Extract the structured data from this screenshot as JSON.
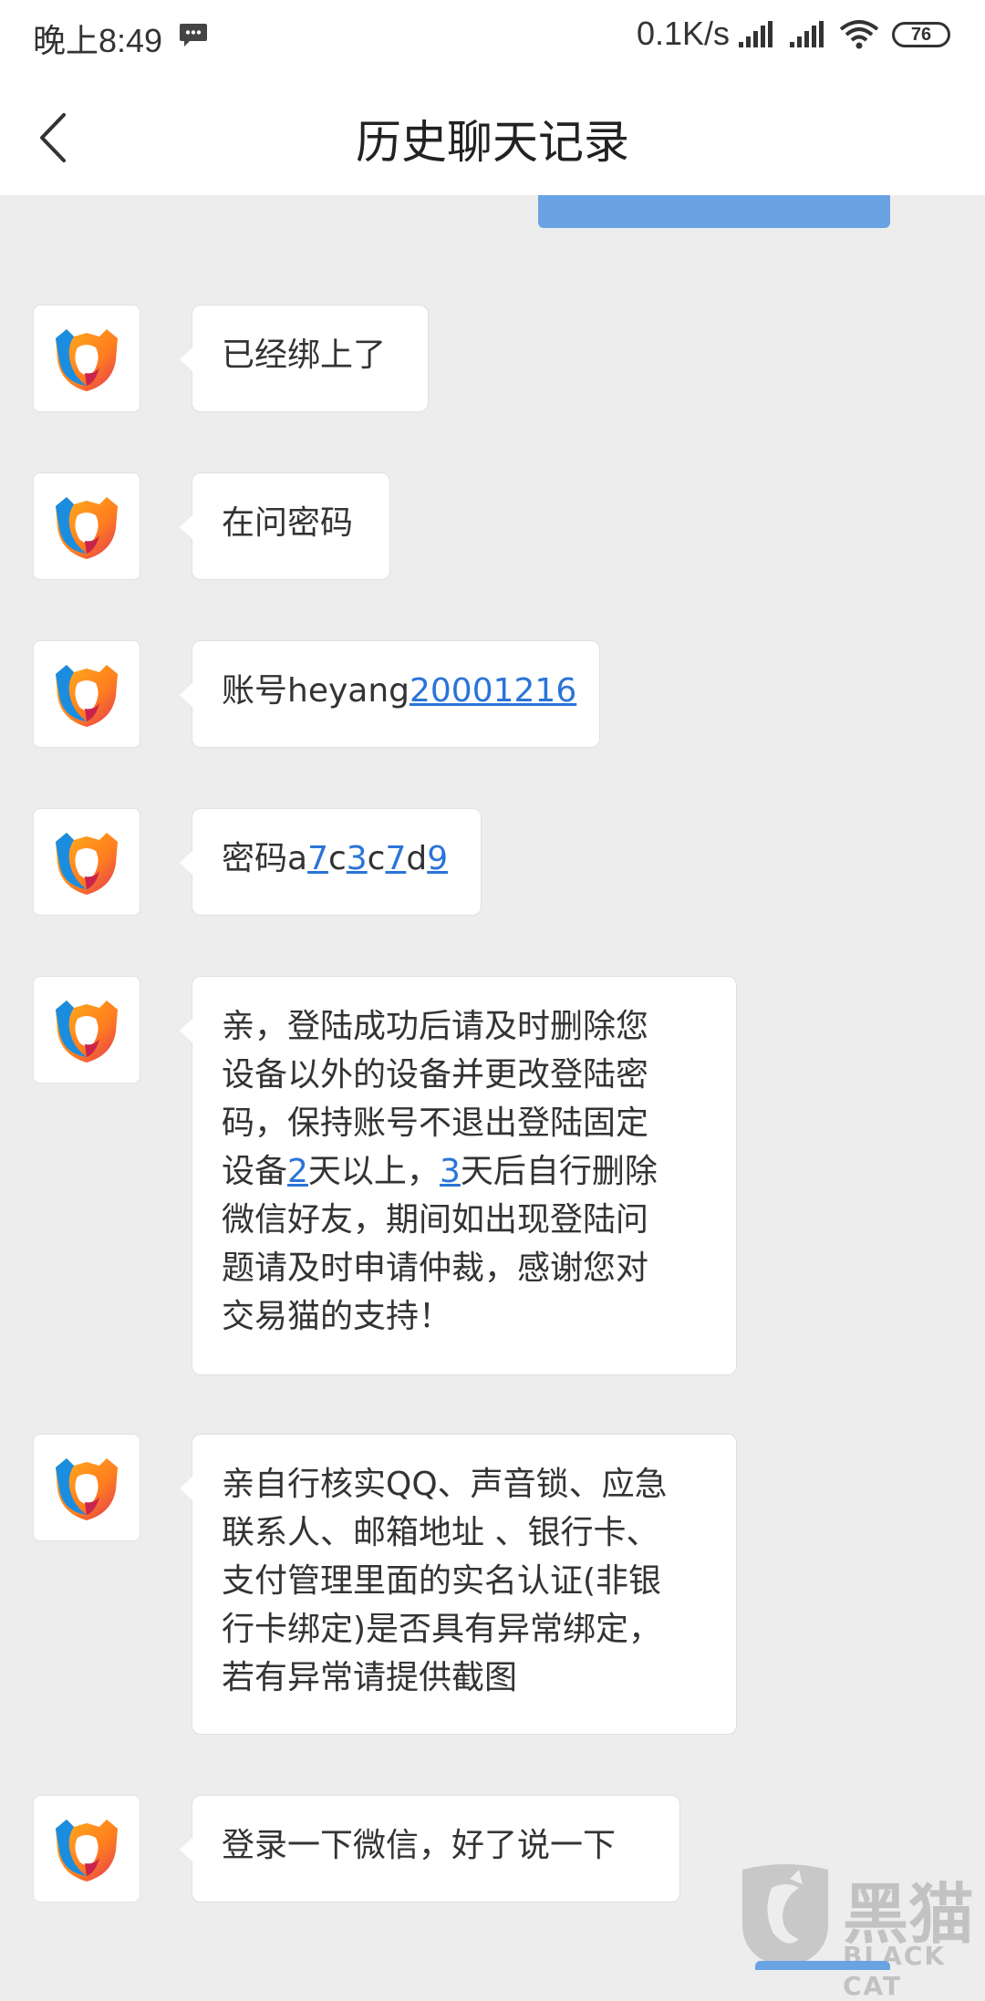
{
  "status_bar": {
    "time": "晚上8:49",
    "network_speed": "0.1K/s",
    "battery": "76",
    "icons": [
      "message-notification-icon",
      "signal-icon",
      "signal-icon",
      "wifi-icon",
      "battery-icon"
    ]
  },
  "header": {
    "title": "历史聊天记录",
    "back_icon": "chevron-left-icon"
  },
  "messages": [
    {
      "sender_avatar": "app-logo-avatar",
      "parts": [
        {
          "text": "已经绑上了"
        }
      ]
    },
    {
      "sender_avatar": "app-logo-avatar",
      "parts": [
        {
          "text": "在问密码"
        }
      ]
    },
    {
      "sender_avatar": "app-logo-avatar",
      "parts": [
        {
          "text": "账号heyang"
        },
        {
          "text": "20001216",
          "link": true
        }
      ]
    },
    {
      "sender_avatar": "app-logo-avatar",
      "parts": [
        {
          "text": "密码a"
        },
        {
          "text": "7",
          "link": true
        },
        {
          "text": "c"
        },
        {
          "text": "3",
          "link": true
        },
        {
          "text": "c"
        },
        {
          "text": "7",
          "link": true
        },
        {
          "text": "d"
        },
        {
          "text": "9",
          "link": true
        }
      ]
    },
    {
      "sender_avatar": "app-logo-avatar",
      "lines": [
        [
          {
            "text": "亲，登陆成功后请及时删除您"
          }
        ],
        [
          {
            "text": "设备以外的设备并更改登陆密"
          }
        ],
        [
          {
            "text": "码，保持账号不退出登陆固定"
          }
        ],
        [
          {
            "text": "设备"
          },
          {
            "text": "2",
            "link": true
          },
          {
            "text": "天以上，"
          },
          {
            "text": "3",
            "link": true
          },
          {
            "text": "天后自行删除"
          }
        ],
        [
          {
            "text": "微信好友，期间如出现登陆问"
          }
        ],
        [
          {
            "text": "题请及时申请仲裁，感谢您对"
          }
        ],
        [
          {
            "text": "交易猫的支持！"
          }
        ]
      ]
    },
    {
      "sender_avatar": "app-logo-avatar",
      "lines": [
        [
          {
            "text": "亲自行核实QQ、声音锁、应急"
          }
        ],
        [
          {
            "text": "联系人、邮箱地址 、银行卡、"
          }
        ],
        [
          {
            "text": "支付管理里面的实名认证(非银"
          }
        ],
        [
          {
            "text": "行卡绑定)是否具有异常绑定，"
          }
        ],
        [
          {
            "text": "若有异常请提供截图"
          }
        ]
      ]
    },
    {
      "sender_avatar": "app-logo-avatar",
      "parts": [
        {
          "text": "登录一下微信，好了说一下"
        }
      ]
    }
  ],
  "watermark": {
    "title": "黑猫",
    "subtitle": "BLACK CAT"
  },
  "colors": {
    "background": "#ededed",
    "bubble": "#ffffff",
    "link": "#2a74d8",
    "self_bubble": "#6aa3e3"
  }
}
